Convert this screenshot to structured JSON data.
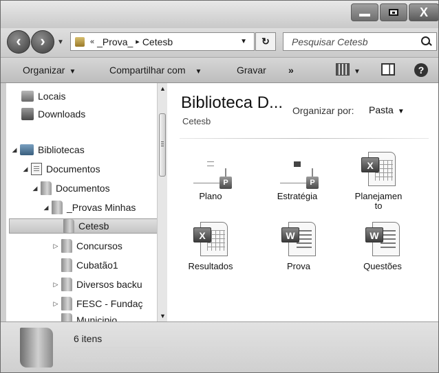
{
  "window": {
    "controls": {
      "minimize": "—",
      "maximize": "□",
      "close": "X"
    }
  },
  "navigation": {
    "back_icon": "back-arrow-icon",
    "forward_icon": "forward-arrow-icon",
    "breadcrumb": [
      "_Prova_",
      "Cetesb"
    ],
    "breadcrumb_prefix": "«",
    "breadcrumb_sep": "▸",
    "search_placeholder": "Pesquisar Cetesb",
    "refresh_icon": "↻"
  },
  "toolbar": {
    "organize": "Organizar",
    "share": "Compartilhar com",
    "burn": "Gravar",
    "more": "»"
  },
  "tree": [
    {
      "label": "Locais",
      "icon": "favorites-icon",
      "expander": ""
    },
    {
      "label": "Downloads",
      "icon": "downloads-icon",
      "expander": ""
    },
    {
      "label": "Bibliotecas",
      "icon": "libraries-icon",
      "expander": "◢"
    },
    {
      "label": "Documentos",
      "icon": "documents-library-icon",
      "expander": "◢"
    },
    {
      "label": "Documentos",
      "icon": "documents-folder-icon",
      "expander": "◢"
    },
    {
      "label": "_Provas Minhas",
      "icon": "folder-icon",
      "expander": "◢"
    },
    {
      "label": "Cetesb",
      "icon": "folder-icon",
      "expander": "",
      "selected": true
    },
    {
      "label": "Concursos",
      "icon": "folder-icon",
      "expander": "▷"
    },
    {
      "label": "Cubatão1",
      "icon": "folder-icon",
      "expander": ""
    },
    {
      "label": "Diversos backu",
      "icon": "folder-icon",
      "expander": "▷"
    },
    {
      "label": "FESC - Fundaç",
      "icon": "folder-icon",
      "expander": "▷"
    },
    {
      "label": "Municipio",
      "icon": "folder-icon",
      "expander": ""
    }
  ],
  "content": {
    "title": "Biblioteca D...",
    "subtitle": "Cetesb",
    "arrange_label": "Organizar por:",
    "arrange_value": "Pasta",
    "files": [
      {
        "name": "Plano",
        "type": "generic",
        "badge": "P"
      },
      {
        "name": "Estratégia",
        "type": "generic",
        "badge": "P"
      },
      {
        "name": "Planejamento",
        "type": "excel",
        "badge": "X"
      },
      {
        "name": "Resultados",
        "type": "excel",
        "badge": "X"
      },
      {
        "name": "Prova",
        "type": "word",
        "badge": "W"
      },
      {
        "name": "Questões",
        "type": "word",
        "badge": "W"
      }
    ]
  },
  "details": {
    "count": "6 itens"
  }
}
